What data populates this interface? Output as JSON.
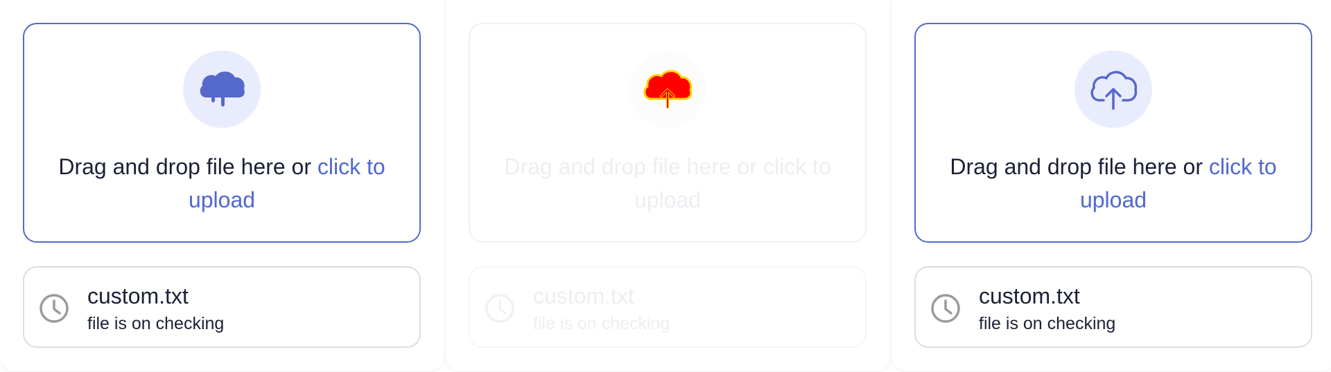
{
  "colors": {
    "accent": "#5469c9",
    "link": "#4e68cf",
    "text": "#1b2036",
    "icon_bg": "#e9ecfd",
    "disabled_text": "#eceef2",
    "error_red": "#ff0000"
  },
  "panels": [
    {
      "state": "active",
      "icon": "cloud-drip-icon",
      "drop_text": "Drag and drop file here or ",
      "link_text": "click to upload",
      "file": {
        "name": "custom.txt",
        "status": "file is on checking",
        "icon": "clock-icon"
      }
    },
    {
      "state": "disabled",
      "icon": "cloud-upload-icon",
      "drop_text": "Drag and drop file here or ",
      "link_text": "click to upload",
      "file": {
        "name": "custom.txt",
        "status": "file is on checking",
        "icon": "clock-icon"
      }
    },
    {
      "state": "active",
      "icon": "cloud-upload-outline-icon",
      "drop_text": "Drag and drop file here or ",
      "link_text": "click to upload",
      "file": {
        "name": "custom.txt",
        "status": "file is on checking",
        "icon": "clock-icon"
      }
    }
  ]
}
